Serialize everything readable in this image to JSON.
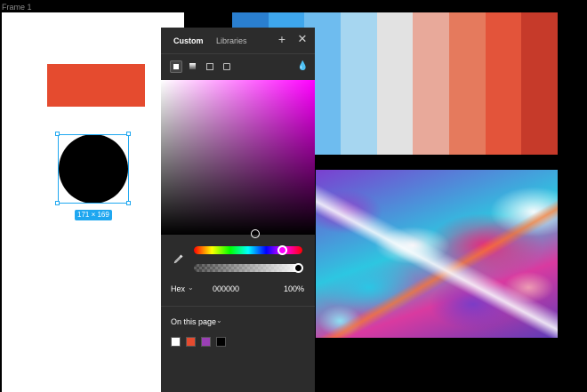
{
  "canvas": {
    "frame_label": "Frame 1",
    "dimension_badge": "171 × 169",
    "shape_colors": {
      "rectangle": "#e54b2f",
      "circle": "#000000",
      "selection": "#1fa7f0"
    }
  },
  "palette": {
    "swatches": [
      "#2a7fd0",
      "#3ea6ec",
      "#6ebcef",
      "#a6d6f0",
      "#e2e2e2",
      "#e8a99a",
      "#e57a5d",
      "#e3543a",
      "#c63a2a"
    ]
  },
  "image": {
    "description_icon": "marble-image"
  },
  "color_picker": {
    "tabs": [
      {
        "label": "Custom",
        "active": true
      },
      {
        "label": "Libraries",
        "active": false
      }
    ],
    "icons": {
      "add": "plus-icon",
      "close": "close-icon",
      "blend": "drop-icon",
      "eyedropper": "eyedropper-icon"
    },
    "fill_types": [
      "solid",
      "gradient",
      "image",
      "video"
    ],
    "color_mode": "Hex",
    "hex": "000000",
    "opacity": "100%",
    "hue_position": 0.83,
    "alpha_position": 1.0,
    "saturation": 0.6,
    "brightness": 0.0,
    "document_colors_label": "On this page",
    "document_colors": [
      "#ffffff",
      "#e54b2f",
      "#9b3fb5",
      "#000000"
    ]
  }
}
